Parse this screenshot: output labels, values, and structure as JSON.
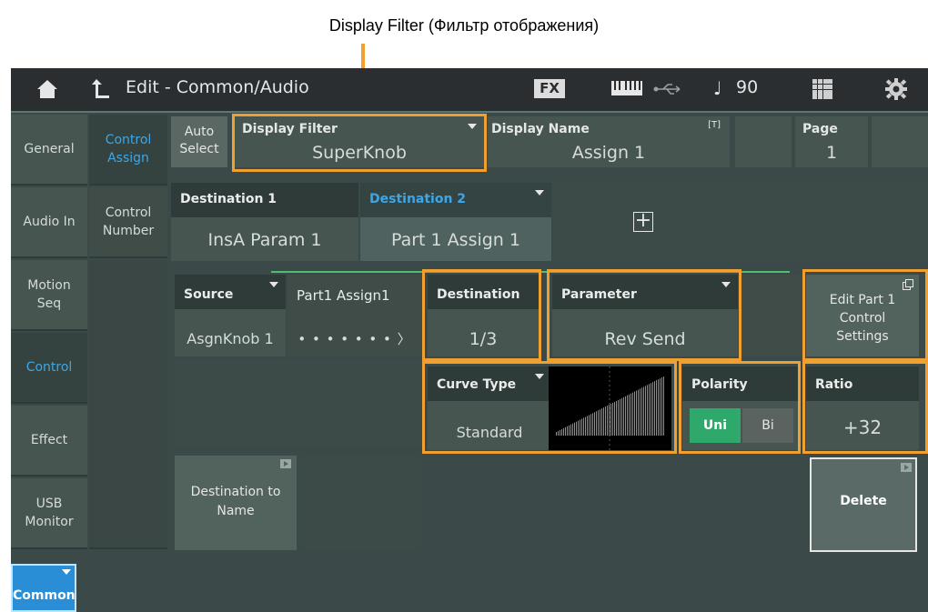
{
  "annotation": {
    "label": "Display Filter (Фильтр отображения)"
  },
  "topbar": {
    "title": "Edit - Common/Audio",
    "fx_label": "FX",
    "tempo": "90",
    "icons": [
      "home-icon",
      "back-icon",
      "keyboard-icon",
      "usb-icon",
      "note-icon",
      "grid-icon",
      "gear-icon"
    ]
  },
  "sidebar": {
    "categories": [
      {
        "label": "General"
      },
      {
        "label": "Audio In"
      },
      {
        "label": "Motion Seq"
      },
      {
        "label": "Control",
        "selected": true
      },
      {
        "label": "Effect"
      },
      {
        "label": "USB Monitor"
      }
    ],
    "subtabs": [
      {
        "label": "Control Assign",
        "selected": true
      },
      {
        "label": "Control Number"
      }
    ],
    "common_button": "Common"
  },
  "header_row": {
    "auto_select": "Auto Select",
    "display_filter": {
      "label": "Display Filter",
      "value": "SuperKnob"
    },
    "display_name": {
      "label": "Display Name",
      "badge": "[T]",
      "value": "Assign 1"
    },
    "page": {
      "label": "Page",
      "value": "1"
    }
  },
  "destinations": {
    "dest1": {
      "label": "Destination 1",
      "value": "InsA Param 1"
    },
    "dest2": {
      "label": "Destination 2",
      "value": "Part 1 Assign 1"
    },
    "add_symbol": "+"
  },
  "routing": {
    "source": {
      "label": "Source",
      "value": "AsgnKnob 1"
    },
    "part_assign": {
      "label": "Part1 Assign1",
      "value": "• • • • • • • 〉"
    },
    "destination": {
      "label": "Destination",
      "value": "1/3"
    },
    "parameter": {
      "label": "Parameter",
      "value": "Rev Send"
    },
    "edit_part": "Edit Part 1 Control Settings"
  },
  "curve": {
    "curve_type": {
      "label": "Curve Type",
      "value": "Standard"
    },
    "polarity": {
      "label": "Polarity",
      "uni": "Uni",
      "bi": "Bi",
      "selected": "Uni"
    },
    "ratio": {
      "label": "Ratio",
      "value": "+32"
    }
  },
  "bottom": {
    "destination_to_name": "Destination to Name",
    "delete": "Delete"
  },
  "colors": {
    "accent_blue": "#3ea6e6",
    "highlight_orange": "#f0a030",
    "uni_green": "#2fa86b"
  }
}
